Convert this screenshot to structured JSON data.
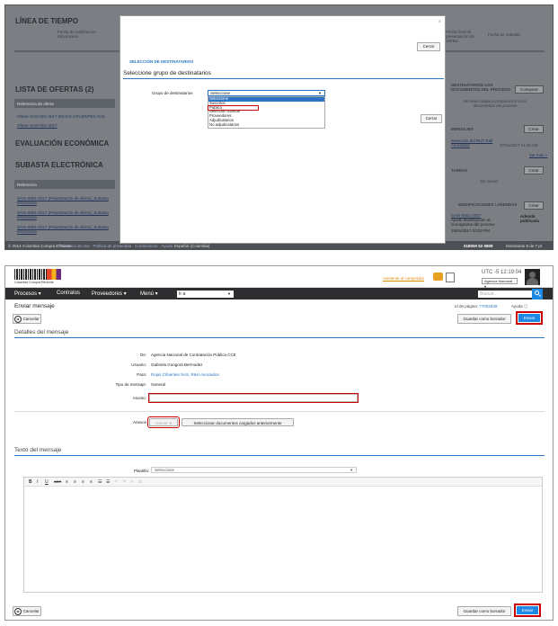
{
  "background": {
    "timeline_title": "LÍNEA DE TIEMPO",
    "timeline_col1": "Fecha de publicación del proceso",
    "timeline_col2": "Fecha final de presentación de ofertas",
    "timeline_col3": "Fecha de subasta",
    "offers_title": "LISTA DE OFERTAS (2)",
    "offers_ref_header": "Referencia de oferta",
    "offer_1": "Oferta SASI-001-2017 ROJAS CIFUENTES SAS",
    "offer_2": "Oferta SASI-001-2017",
    "eval_title": "EVALUACIÓN ECONÓMICA",
    "auction_title": "SUBASTA ELECTRÓNICA",
    "auction_ref": "Referencia",
    "auction_row_1": "SASI-0001-2017 (Presentación de oferta)_Subasta electrónica",
    "auction_row_2": "SASI-0001-2017 (Presentación de oferta)_Subasta electrónica",
    "auction_row_3": "SASI-0001-2017 (Presentación de oferta)_Subasta electrónica",
    "recipients_title": "DESTINATARIOS LOS DOCUMENTOS DEL PROCESO",
    "recipients_note": "No tiene ninguna preparación a los documentos del proceso",
    "messages_title": "MENSAJES",
    "message_sender": "Selección del RUT Ráfi Asociados",
    "message_date": "27/01/2017 11:48 AM",
    "see_more": "Ver más »",
    "tasks_title": "TAREAS",
    "tasks_note": "Sin tareas",
    "mods_title": "MODIFICACIONES / ADENDAS",
    "mod_ref": "SASI-0001-2017",
    "mod_text": "Ajuste Modificación al cronograma del proceso",
    "mod_date": "25/01/2017 03:52 PM",
    "mod_status": "Adenda publicada",
    "compare_btn": "Comparar",
    "create_btn": "Crear",
    "footer_left": "© 2014 Colombia Compra Eficiente",
    "footer_links": "Términos de uso · Política de privacidad · Contáctenos · Ayuda",
    "footer_lang": "Español (Colombia)",
    "footer_phone": "018000 52 0808",
    "footer_page": "Mostrando 8 de 7 pt"
  },
  "modal": {
    "close_icon_char": "×",
    "close_btn_top": "Cerrar",
    "close_btn_bottom": "Cerrar",
    "section_title": "SELECCIÓN DE DESTINATARIOS",
    "group_heading": "Seleccione grupo de destinatarios",
    "group_label": "Grupo de destinatarios",
    "group_selected": "Seleccione",
    "group_options": [
      "Seleccione",
      "Suscritos",
      "Público",
      "Selección manual",
      "Proveedores",
      "Adjudicatarios",
      "No adjudicatarios"
    ]
  },
  "header": {
    "logo_caption": "Colombia Compra Eficiente",
    "support_link": "Asistente al comprador",
    "timezone": "UTC -5 12:19:04",
    "entity": "Agencia Nacional...",
    "nav_items": [
      "Procesos ▾",
      "Contratos",
      "Proveedores ▾",
      "Menú ▾"
    ],
    "goto_placeholder": "Ir a",
    "search_placeholder": "Buscar..."
  },
  "page": {
    "title": "Enviar mensaje",
    "id_label": "Id de página:",
    "id_value": "77003349",
    "help": "Ayuda ⓘ",
    "cancel": "Cancelar",
    "save_draft": "Guardar como borrador",
    "send": "Enviar"
  },
  "details": {
    "section": "Detalles del mensaje",
    "from_label": "De:",
    "from_value": "Agencia Nacional de Contratación Pública CCE",
    "user_label": "Usuario:",
    "user_value": "Gabriela Gongora Bermudez",
    "to_label": "Para:",
    "to_value": "Rojas Cifuentes SAS, R&H Asociados",
    "type_label": "Tipo de mensaje:",
    "type_value": "General",
    "subject_label": "Asunto:",
    "subject_value": "",
    "annex_label": "Anexos",
    "annex_btn": "Anexar",
    "prev_docs_btn": "Seleccionar documentos cargados anteriormente"
  },
  "text": {
    "section": "Texto del mensaje",
    "template_label": "Plantilla:",
    "template_value": "Seleccione"
  },
  "toolbar_glyphs": [
    "B",
    "I",
    "U",
    "ABC",
    "≡",
    "≡",
    "≡",
    "≡",
    "☰",
    "☰",
    "↶",
    "↷",
    "∞",
    "⊘"
  ],
  "colors": {
    "accent": "#1e88e5",
    "highlight": "#cc0000",
    "link": "#2a74c2",
    "nav": "#2e2e30"
  }
}
